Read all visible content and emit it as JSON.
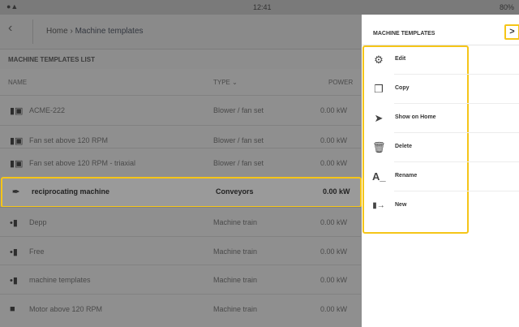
{
  "status": {
    "time": "12:41",
    "battery": "80%"
  },
  "nav": {
    "home": "Home",
    "separator": "›",
    "current": "Machine templates"
  },
  "list": {
    "title": "MACHINE TEMPLATES LIST",
    "columns": {
      "name": "NAME",
      "type": "TYPE",
      "type_sort": "⌄",
      "power": "POWER"
    },
    "rows": [
      {
        "name": "ACME-222",
        "type": "Blower / fan set",
        "power": "0.00 kW",
        "icon": "fan-set-icon"
      },
      {
        "name": "Fan set above 120 RPM",
        "type": "Blower / fan set",
        "power": "0.00 kW",
        "icon": "fan-set-icon"
      },
      {
        "name": "Fan set above 120 RPM - triaxial",
        "type": "Blower / fan set",
        "power": "0.00 kW",
        "icon": "fan-set-icon"
      },
      {
        "name": "reciprocating machine",
        "type": "Conveyors",
        "power": "0.00 kW",
        "icon": "conveyor-icon"
      },
      {
        "name": "Depp",
        "type": "Machine train",
        "power": "0.00 kW",
        "icon": "machine-train-icon"
      },
      {
        "name": "Free",
        "type": "Machine train",
        "power": "0.00 kW",
        "icon": "machine-train-icon"
      },
      {
        "name": "machine templates",
        "type": "Machine train",
        "power": "0.00 kW",
        "icon": "machine-train-icon"
      },
      {
        "name": "Motor above 120 RPM",
        "type": "Machine train",
        "power": "0.00 kW",
        "icon": "motor-icon"
      }
    ]
  },
  "menu": {
    "title": "MACHINE TEMPLATES",
    "close": ">",
    "items": [
      {
        "label": "Edit",
        "icon": "gear-icon"
      },
      {
        "label": "Copy",
        "icon": "copy-icon"
      },
      {
        "label": "Show on Home",
        "icon": "arrow-icon"
      },
      {
        "label": "Delete",
        "icon": "trash-icon"
      },
      {
        "label": "Rename",
        "icon": "rename-icon"
      },
      {
        "label": "New",
        "icon": "new-icon"
      }
    ]
  },
  "colors": {
    "highlight": "#f5c518",
    "overlay": "#8f8f8f",
    "menu_bg": "#ffffff"
  }
}
